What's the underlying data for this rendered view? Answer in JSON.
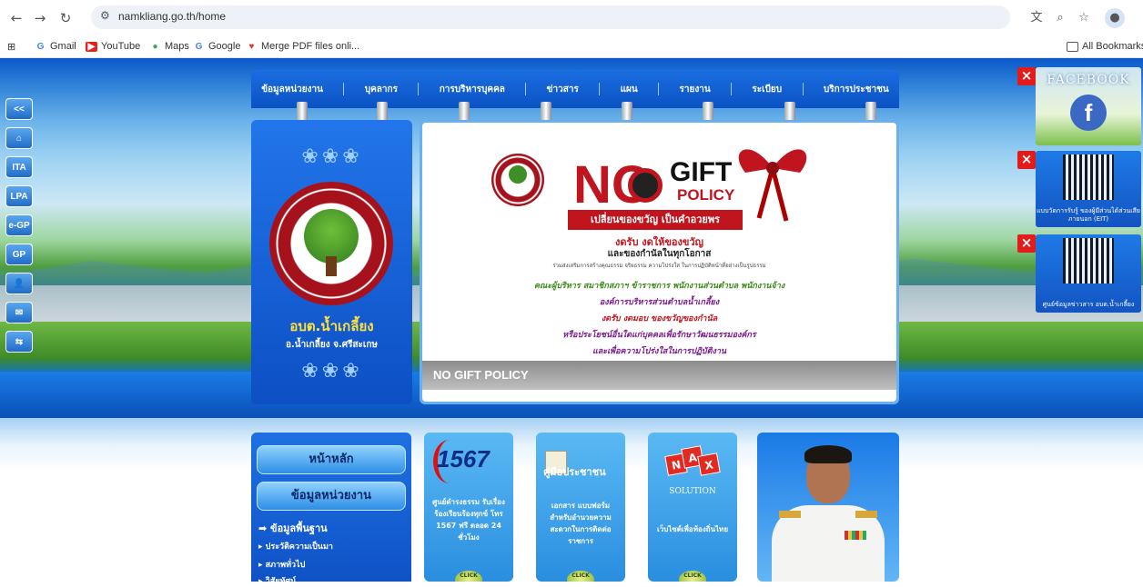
{
  "browser": {
    "url": "namkliang.go.th/home",
    "bookmarks": [
      {
        "label": "Gmail",
        "icon": "google-icon"
      },
      {
        "label": "YouTube",
        "icon": "youtube-icon"
      },
      {
        "label": "Maps",
        "icon": "maps-icon"
      },
      {
        "label": "Google",
        "icon": "google-icon"
      },
      {
        "label": "Merge PDF files onli...",
        "icon": "pdf-icon"
      }
    ],
    "all_bookmarks": "All Bookmarks"
  },
  "side_icons": [
    "<<",
    "⌂",
    "ITA",
    "LPA",
    "e-GP",
    "GP",
    "👤",
    "✉",
    "⇆"
  ],
  "menu": {
    "items": [
      "ข้อมูลหน่วยงาน",
      "บุคลากร",
      "การบริหารบุคคล",
      "ข่าวสาร",
      "แผน",
      "รายงาน",
      "ระเบียบ",
      "บริการประชาชน"
    ]
  },
  "logo_panel": {
    "org_name": "อบต.น้ำเกลี้ยง",
    "org_sub": "อ.น้ำเกลี้ยง จ.ศรีสะเกษ"
  },
  "banner": {
    "no": "NO",
    "gift": "GIFT",
    "policy": "POLICY",
    "ribbon_text": "เปลี่ยนของขวัญ เป็นคำอวยพร",
    "line1": "งดรับ งดให้ของขวัญ",
    "line2": "และของกำนัลในทุกโอกาส",
    "line3": "ร่วมส่งเสริมการสร้างคุณธรรม จริยธรรม ความโปร่งใส ในการปฏิบัติหน้าที่อย่างเป็นรูปธรรม",
    "line4": "คณะผู้บริหาร สมาชิกสภาฯ ข้าราชการ พนักงานส่วนตำบล พนักงานจ้าง",
    "line5": "องค์การบริหารส่วนตำบลน้ำเกลี้ยง",
    "line6": "งดรับ งดมอบ ของขวัญของกำนัล",
    "line7": "หรือประโยชน์อื่นใดแก่บุคคลเพื่อรักษาวัฒนธรรมองค์กร",
    "line8": "และเพื่อความโปร่งใสในการปฏิบัติงาน",
    "caption": "NO GIFT POLICY"
  },
  "right_widgets": {
    "facebook_title": "FACEBOOK",
    "facebook_letter": "f",
    "qr1_text": "แบบวัดการรับรู้ ของผู้มีส่วนได้ส่วนเสียภายนอก (EIT)",
    "qr2_text": "ศูนย์ข้อมูลข่าวสาร อบต.น้ำเกลี้ยง",
    "close": "×"
  },
  "left_menu": {
    "home": "หน้าหลัก",
    "unit_info": "ข้อมูลหน่วยงาน",
    "basic_info": "ข้อมูลพื้นฐาน",
    "history": "ประวัติความเป็นมา",
    "general": "สภาพทั่วไป",
    "more": "วิสัยทัศน์"
  },
  "cards": {
    "c1567": {
      "number": "1567",
      "text": "ศูนย์ดำรงธรรม รับเรื่องร้องเรียนร้องทุกข์ โทร 1567 ฟรี ตลอด 24 ชั่วโมง",
      "click": "CLICK"
    },
    "manual": {
      "title": "คู่มือประชาชน",
      "text": "เอกสาร แบบฟอร์ม สำหรับอำนวยความสะดวกในการติดต่อราชการ",
      "click": "CLICK"
    },
    "nax": {
      "letters": [
        "N",
        "A",
        "X"
      ],
      "solution": "SOLUTION",
      "text": "เว็บไซต์เพื่อท้องถิ่นไทย",
      "click": "CLICK"
    }
  },
  "colors": {
    "primary_blue": "#0b52c4",
    "accent_red": "#c0151e",
    "gold": "#ffe13a"
  }
}
